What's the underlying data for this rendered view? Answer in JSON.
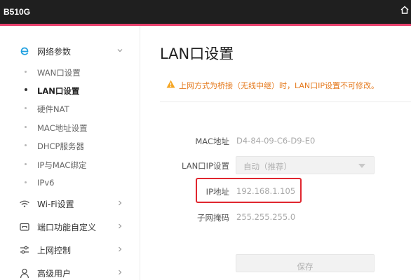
{
  "header": {
    "model": "B510G",
    "home_icon": "home-icon",
    "accent_color": "#e8416d",
    "bar_color": "#1f1f1f"
  },
  "sidebar": {
    "groups": [
      {
        "label": "网络参数",
        "icon": "network-e-icon",
        "expanded": true
      },
      {
        "label": "Wi-Fi设置",
        "icon": "wifi-icon",
        "expanded": false
      },
      {
        "label": "端口功能自定义",
        "icon": "port-icon",
        "expanded": false
      },
      {
        "label": "上网控制",
        "icon": "sliders-icon",
        "expanded": false
      },
      {
        "label": "高级用户",
        "icon": "user-icon",
        "expanded": false
      }
    ],
    "network_items": [
      {
        "label": "WAN口设置",
        "active": false
      },
      {
        "label": "LAN口设置",
        "active": true
      },
      {
        "label": "硬件NAT",
        "active": false
      },
      {
        "label": "MAC地址设置",
        "active": false
      },
      {
        "label": "DHCP服务器",
        "active": false
      },
      {
        "label": "IP与MAC绑定",
        "active": false
      },
      {
        "label": "IPv6",
        "active": false
      }
    ]
  },
  "main": {
    "title": "LAN口设置",
    "warning": "上网方式为桥接（无线中继）时，LAN口IP设置不可修改。",
    "warning_color": "#e57a1e",
    "fields": {
      "mac_label": "MAC地址",
      "mac_value": "D4-84-09-C6-D9-E0",
      "lanip_label": "LAN口IP设置",
      "lanip_value": "自动（推荐）",
      "ip_label": "IP地址",
      "ip_value": "192.168.1.105",
      "mask_label": "子网掩码",
      "mask_value": "255.255.255.0"
    },
    "save_label": "保存",
    "highlight_color": "#e0262f"
  }
}
